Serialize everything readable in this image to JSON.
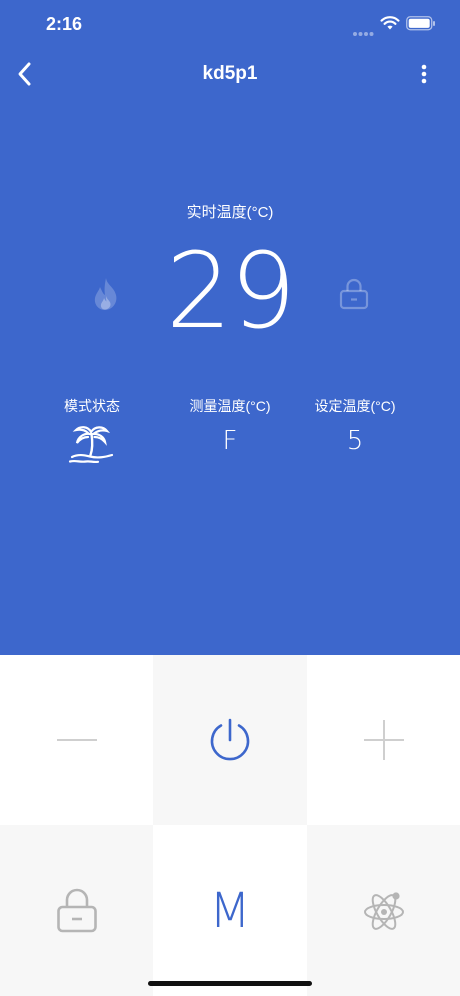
{
  "status_bar": {
    "time": "2:16",
    "signal_icon": "signal-dots-icon",
    "wifi_icon": "wifi-icon",
    "battery_icon": "battery-icon"
  },
  "nav": {
    "title": "kd5p1",
    "back_icon": "chevron-left-icon",
    "more_icon": "more-vertical-icon"
  },
  "display": {
    "realtime_label": "实时温度(°C)",
    "realtime_value": "29",
    "heat_icon": "flame-icon",
    "lock_icon": "lock-icon"
  },
  "info": {
    "mode_label": "模式状态",
    "mode_icon": "palm-tree-icon",
    "measured_label": "测量温度(°C)",
    "measured_value": "F",
    "set_label": "设定温度(°C)",
    "set_value": "5"
  },
  "controls": {
    "minus_icon": "minus-icon",
    "power_icon": "power-icon",
    "plus_icon": "plus-icon",
    "lock_icon": "lock-icon",
    "mode_label": "M",
    "atom_icon": "atom-icon"
  },
  "colors": {
    "primary": "#3d67cc",
    "cell_gray": "#f7f7f7",
    "icon_gray": "#b5b5b5"
  }
}
